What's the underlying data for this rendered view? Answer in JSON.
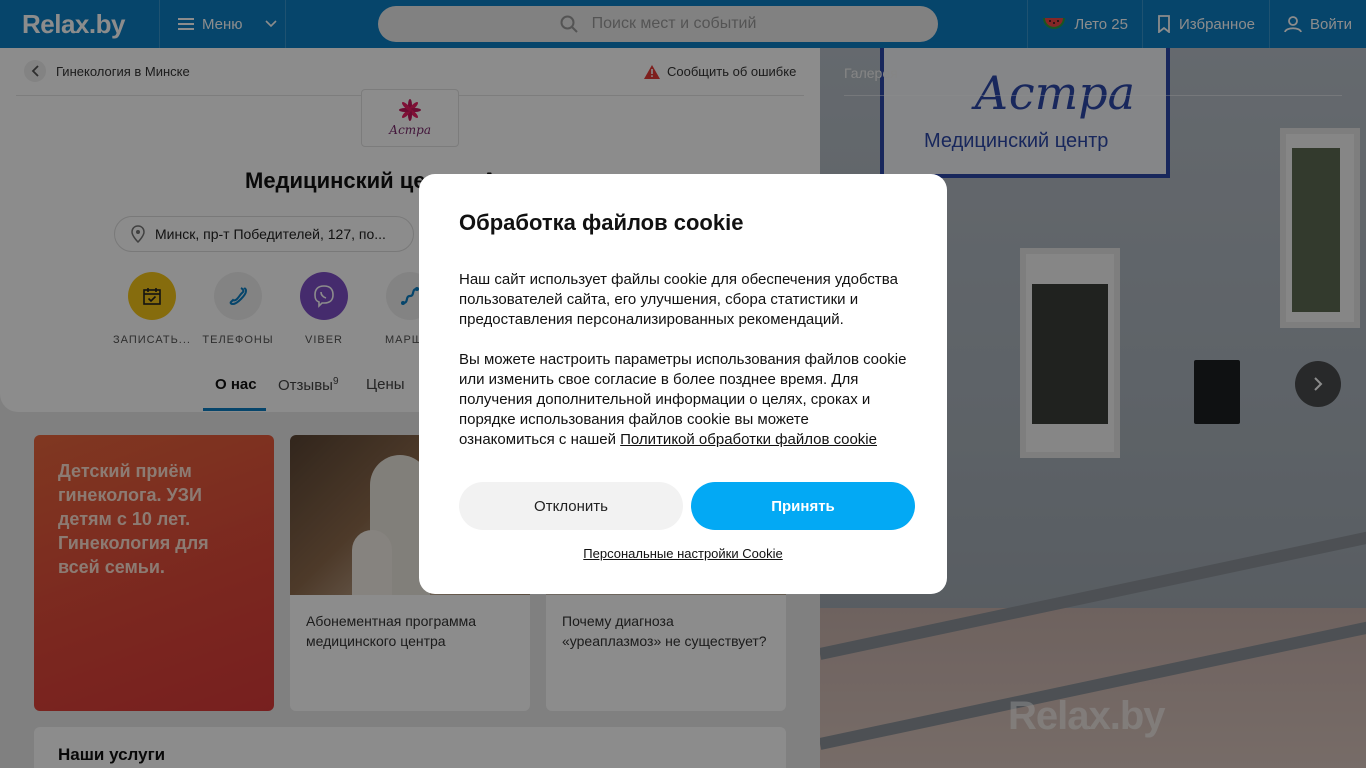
{
  "header": {
    "logo": "Relax.by",
    "menu_label": "Меню",
    "search_placeholder": "Поиск мест и событий",
    "summer_label": "Лето 25",
    "favorites_label": "Избранное",
    "login_label": "Войти"
  },
  "breadcrumb": {
    "back_label": "Гинекология в Минске"
  },
  "report_label": "Сообщить об ошибке",
  "place": {
    "logo_text": "Астра",
    "title": "Медицинский центр «Астра»",
    "address": "Минск, пр-т Победителей, 127, по..."
  },
  "actions": [
    {
      "label": "ЗАПИСАТЬ...",
      "color": "#f5c518"
    },
    {
      "label": "ТЕЛЕФОНЫ",
      "color": "#eeeeee"
    },
    {
      "label": "VIBER",
      "color": "#7f4fc6"
    },
    {
      "label": "МАРШ...",
      "color": "#eeeeee"
    }
  ],
  "tabs": [
    {
      "label": "О нас"
    },
    {
      "label": "Отзывы",
      "count": "9"
    },
    {
      "label": "Цены"
    }
  ],
  "promo": {
    "text": "Детский приём гинеколога. УЗИ детям с 10 лет. Гинекология для всей семьи."
  },
  "cards": [
    {
      "text": "Абонементная программа медицинского центра"
    },
    {
      "text": "Почему диагноза «уреаплазмоз» не существует?"
    }
  ],
  "services_title": "Наши услуги",
  "gallery": {
    "label": "Галерея",
    "sign_title": "Астра",
    "sign_subtitle": "Медицинский центр",
    "watermark": "Relax.by"
  },
  "cookie_modal": {
    "title": "Обработка файлов cookie",
    "paragraph1": "Наш сайт использует файлы cookie для обеспечения удобства пользователей сайта, его улучшения, сбора статистики и предоставления персонализированных рекомендаций.",
    "paragraph2": "Вы можете настроить параметры использования файлов cookie или изменить свое согласие в более позднее время. Для получения дополнительной информации о целях, сроках и порядке использования файлов cookie вы можете ознакомиться с нашей",
    "policy_link": "Политикой обработки файлов cookie",
    "decline_label": "Отклонить",
    "accept_label": "Принять",
    "settings_label": "Персональные настройки Cookie"
  },
  "colors": {
    "brand": "#0b7fc4",
    "accept": "#03a9f4",
    "promo": "#e0473a"
  }
}
